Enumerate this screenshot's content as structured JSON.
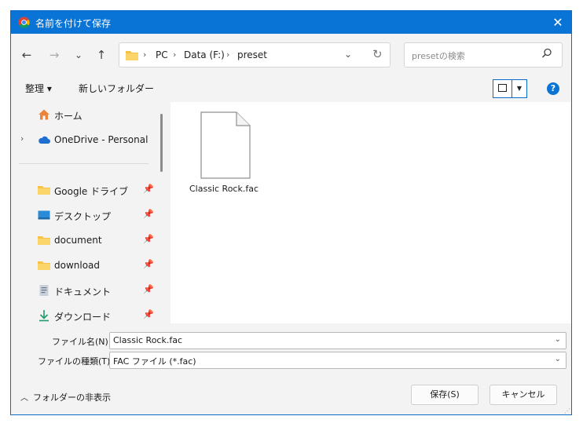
{
  "window": {
    "title": "名前を付けて保存",
    "close_glyph": "✕"
  },
  "nav": {
    "back": "←",
    "forward": "→",
    "recent": "⌄",
    "up": "↑"
  },
  "address": {
    "crumbs": [
      "PC",
      "Data (F:)",
      "preset"
    ],
    "separator": "›",
    "dropdown": "⌄",
    "refresh": "↻"
  },
  "search": {
    "placeholder": "presetの検索"
  },
  "toolbar": {
    "organize": "整理 ▾",
    "new_folder": "新しいフォルダー",
    "view_arrow": "▼",
    "help": "?"
  },
  "sidebar": {
    "items": [
      {
        "label": "ホーム",
        "icon": "home-icon"
      },
      {
        "label": "OneDrive - Personal",
        "icon": "cloud-icon",
        "expander": "›"
      },
      {
        "label": "Google ドライブ",
        "icon": "folder-icon",
        "pinned": true
      },
      {
        "label": "デスクトップ",
        "icon": "desktop-icon",
        "pinned": true
      },
      {
        "label": "document",
        "icon": "folder-icon",
        "pinned": true
      },
      {
        "label": "download",
        "icon": "folder-icon",
        "pinned": true
      },
      {
        "label": "ドキュメント",
        "icon": "documents-icon",
        "pinned": true
      },
      {
        "label": "ダウンロード",
        "icon": "download-icon",
        "pinned": true
      }
    ]
  },
  "files": [
    {
      "name": "Classic Rock.fac",
      "icon": "file-icon"
    }
  ],
  "form": {
    "filename_label": "ファイル名(N):",
    "filename_value": "Classic Rock.fac",
    "filetype_label": "ファイルの種類(T):",
    "filetype_value": "FAC ファイル (*.fac)"
  },
  "footer": {
    "hide_folders": "フォルダーの非表示",
    "save": "保存(S)",
    "cancel": "キャンセル"
  },
  "colors": {
    "titlebar": "#0a74d6",
    "folder": "#f5c147",
    "accent": "#0a6bc8"
  }
}
